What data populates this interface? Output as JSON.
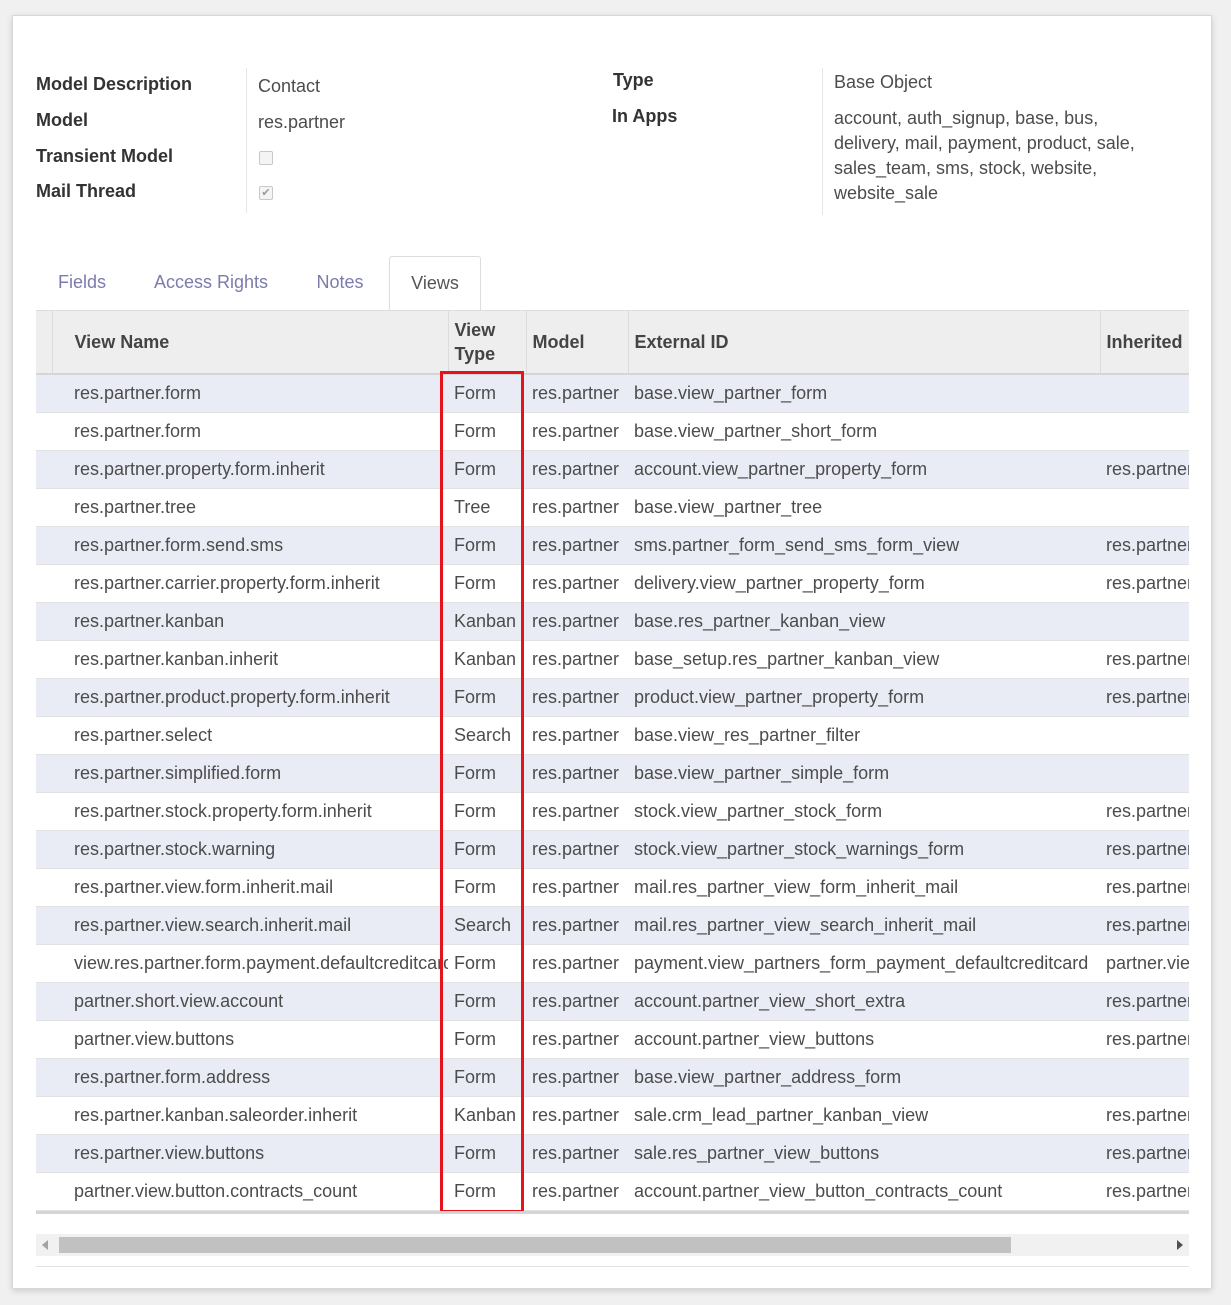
{
  "general": {
    "left_fields": [
      {
        "label": "Model Description",
        "value": "Contact"
      },
      {
        "label": "Model",
        "value": "res.partner"
      },
      {
        "label": "Transient Model",
        "checked": false
      },
      {
        "label": "Mail Thread",
        "checked": true
      }
    ],
    "type_label": "Type",
    "type_value": "Base Object",
    "in_apps_label": "In Apps",
    "in_apps_value": "account, auth_signup, base, bus, delivery, mail, payment, product, sale, sales_team, sms, stock, website, website_sale"
  },
  "tabs": [
    {
      "label": "Fields",
      "active": false
    },
    {
      "label": "Access Rights",
      "active": false
    },
    {
      "label": "Notes",
      "active": false
    },
    {
      "label": "Views",
      "active": true
    }
  ],
  "table": {
    "headers": [
      "View Name",
      "View Type",
      "Model",
      "External ID",
      "Inherited"
    ],
    "rows": [
      [
        "res.partner.form",
        "Form",
        "res.partner",
        "base.view_partner_form",
        ""
      ],
      [
        "res.partner.form",
        "Form",
        "res.partner",
        "base.view_partner_short_form",
        ""
      ],
      [
        "res.partner.property.form.inherit",
        "Form",
        "res.partner",
        "account.view_partner_property_form",
        "res.partner"
      ],
      [
        "res.partner.tree",
        "Tree",
        "res.partner",
        "base.view_partner_tree",
        ""
      ],
      [
        "res.partner.form.send.sms",
        "Form",
        "res.partner",
        "sms.partner_form_send_sms_form_view",
        "res.partner"
      ],
      [
        "res.partner.carrier.property.form.inherit",
        "Form",
        "res.partner",
        "delivery.view_partner_property_form",
        "res.partner"
      ],
      [
        "res.partner.kanban",
        "Kanban",
        "res.partner",
        "base.res_partner_kanban_view",
        ""
      ],
      [
        "res.partner.kanban.inherit",
        "Kanban",
        "res.partner",
        "base_setup.res_partner_kanban_view",
        "res.partner"
      ],
      [
        "res.partner.product.property.form.inherit",
        "Form",
        "res.partner",
        "product.view_partner_property_form",
        "res.partner"
      ],
      [
        "res.partner.select",
        "Search",
        "res.partner",
        "base.view_res_partner_filter",
        ""
      ],
      [
        "res.partner.simplified.form",
        "Form",
        "res.partner",
        "base.view_partner_simple_form",
        ""
      ],
      [
        "res.partner.stock.property.form.inherit",
        "Form",
        "res.partner",
        "stock.view_partner_stock_form",
        "res.partner"
      ],
      [
        "res.partner.stock.warning",
        "Form",
        "res.partner",
        "stock.view_partner_stock_warnings_form",
        "res.partner"
      ],
      [
        "res.partner.view.form.inherit.mail",
        "Form",
        "res.partner",
        "mail.res_partner_view_form_inherit_mail",
        "res.partner"
      ],
      [
        "res.partner.view.search.inherit.mail",
        "Search",
        "res.partner",
        "mail.res_partner_view_search_inherit_mail",
        "res.partner"
      ],
      [
        "view.res.partner.form.payment.defaultcreditcard",
        "Form",
        "res.partner",
        "payment.view_partners_form_payment_defaultcreditcard",
        "partner.view"
      ],
      [
        "partner.short.view.account",
        "Form",
        "res.partner",
        "account.partner_view_short_extra",
        "res.partner"
      ],
      [
        "partner.view.buttons",
        "Form",
        "res.partner",
        "account.partner_view_buttons",
        "res.partner"
      ],
      [
        "res.partner.form.address",
        "Form",
        "res.partner",
        "base.view_partner_address_form",
        ""
      ],
      [
        "res.partner.kanban.saleorder.inherit",
        "Kanban",
        "res.partner",
        "sale.crm_lead_partner_kanban_view",
        "res.partner"
      ],
      [
        "res.partner.view.buttons",
        "Form",
        "res.partner",
        "sale.res_partner_view_buttons",
        "res.partner"
      ],
      [
        "partner.view.button.contracts_count",
        "Form",
        "res.partner",
        "account.partner_view_button_contracts_count",
        "res.partner"
      ]
    ]
  },
  "colors": {
    "highlight": "#e5131c",
    "tab_link": "#7c7bad",
    "row_alt": "#eaecf5"
  }
}
